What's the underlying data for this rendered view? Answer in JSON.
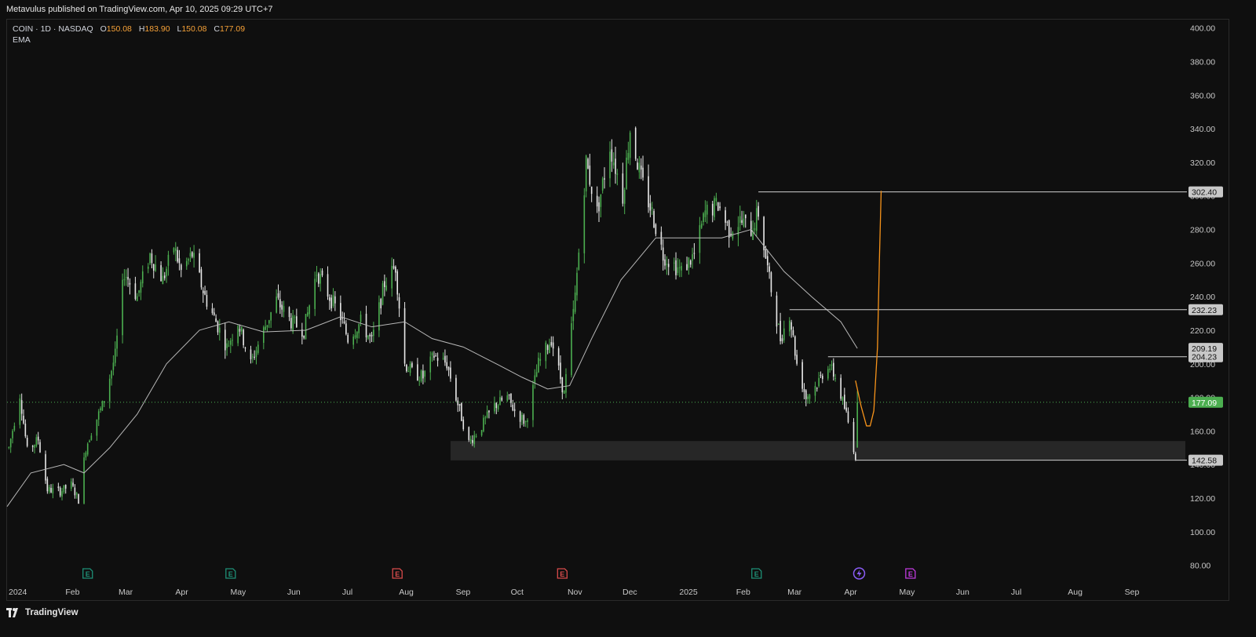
{
  "header": {
    "publisher": "Metavulus published on TradingView.com, Apr 10, 2025 09:29 UTC+7"
  },
  "legend": {
    "symbol": "COIN · 1D · NASDAQ",
    "o_label": "O",
    "o_value": "150.08",
    "h_label": "H",
    "h_value": "183.90",
    "l_label": "L",
    "l_value": "150.08",
    "c_label": "C",
    "c_value": "177.09",
    "indicator": "EMA"
  },
  "footer": {
    "brand": "TradingView"
  },
  "colors": {
    "background": "#0f0f0f",
    "up": "#4caf50",
    "down": "#e8e8e8",
    "ema": "#b8b8b8",
    "projection": "#f7931a",
    "level_line": "#d0d0d0",
    "price_badge": "#4caf50",
    "zone": "#2a2a2a",
    "earnings_teal": "#1e8f76",
    "earnings_red": "#d84b4b",
    "earnings_magenta": "#c03adf",
    "dividend_purple": "#8a5cf6"
  },
  "chart_data": {
    "type": "candlestick",
    "symbol": "COIN",
    "interval": "1D",
    "exchange": "NASDAQ",
    "ylim": [
      70,
      405
    ],
    "y_ticks": [
      80,
      100,
      120,
      140,
      160,
      180,
      200,
      220,
      240,
      260,
      280,
      300,
      320,
      340,
      360,
      380,
      400
    ],
    "y_tick_labels": [
      "80.00",
      "100.00",
      "120.00",
      "140.00",
      "160.00",
      "180.00",
      "200.00",
      "220.00",
      "240.00",
      "260.00",
      "280.00",
      "300.00",
      "320.00",
      "340.00",
      "360.00",
      "380.00",
      "400.00"
    ],
    "x_range": [
      "2024-01-01",
      "2025-10-05"
    ],
    "x_ticks": [
      {
        "date": "2024-01-01",
        "label": "2024"
      },
      {
        "date": "2024-02-01",
        "label": "Feb"
      },
      {
        "date": "2024-03-01",
        "label": "Mar"
      },
      {
        "date": "2024-04-01",
        "label": "Apr"
      },
      {
        "date": "2024-05-01",
        "label": "May"
      },
      {
        "date": "2024-06-01",
        "label": "Jun"
      },
      {
        "date": "2024-07-01",
        "label": "Jul"
      },
      {
        "date": "2024-08-01",
        "label": "Aug"
      },
      {
        "date": "2024-09-01",
        "label": "Sep"
      },
      {
        "date": "2024-10-01",
        "label": "Oct"
      },
      {
        "date": "2024-11-01",
        "label": "Nov"
      },
      {
        "date": "2024-12-01",
        "label": "Dec"
      },
      {
        "date": "2025-01-01",
        "label": "2025"
      },
      {
        "date": "2025-02-01",
        "label": "Feb"
      },
      {
        "date": "2025-03-01",
        "label": "Mar"
      },
      {
        "date": "2025-04-01",
        "label": "Apr"
      },
      {
        "date": "2025-05-01",
        "label": "May"
      },
      {
        "date": "2025-06-01",
        "label": "Jun"
      },
      {
        "date": "2025-07-01",
        "label": "Jul"
      },
      {
        "date": "2025-08-01",
        "label": "Aug"
      },
      {
        "date": "2025-09-01",
        "label": "Sep"
      }
    ],
    "price_path": [
      [
        "2024-01-02",
        150
      ],
      [
        "2024-01-08",
        182
      ],
      [
        "2024-01-12",
        148
      ],
      [
        "2024-01-18",
        155
      ],
      [
        "2024-01-23",
        125
      ],
      [
        "2024-01-30",
        124
      ],
      [
        "2024-02-05",
        128
      ],
      [
        "2024-02-09",
        119
      ],
      [
        "2024-02-13",
        150
      ],
      [
        "2024-02-16",
        160
      ],
      [
        "2024-02-22",
        175
      ],
      [
        "2024-02-29",
        205
      ],
      [
        "2024-03-05",
        255
      ],
      [
        "2024-03-12",
        240
      ],
      [
        "2024-03-19",
        265
      ],
      [
        "2024-03-26",
        250
      ],
      [
        "2024-04-01",
        270
      ],
      [
        "2024-04-05",
        255
      ],
      [
        "2024-04-11",
        265
      ],
      [
        "2024-04-18",
        240
      ],
      [
        "2024-04-24",
        225
      ],
      [
        "2024-04-30",
        210
      ],
      [
        "2024-05-06",
        225
      ],
      [
        "2024-05-13",
        200
      ],
      [
        "2024-05-20",
        220
      ],
      [
        "2024-05-27",
        238
      ],
      [
        "2024-06-04",
        225
      ],
      [
        "2024-06-11",
        220
      ],
      [
        "2024-06-18",
        255
      ],
      [
        "2024-06-25",
        240
      ],
      [
        "2024-07-01",
        228
      ],
      [
        "2024-07-05",
        215
      ],
      [
        "2024-07-12",
        225
      ],
      [
        "2024-07-18",
        213
      ],
      [
        "2024-07-25",
        248
      ],
      [
        "2024-07-31",
        258
      ],
      [
        "2024-08-05",
        200
      ],
      [
        "2024-08-09",
        195
      ],
      [
        "2024-08-15",
        192
      ],
      [
        "2024-08-21",
        205
      ],
      [
        "2024-08-28",
        200
      ],
      [
        "2024-09-04",
        172
      ],
      [
        "2024-09-09",
        153
      ],
      [
        "2024-09-16",
        163
      ],
      [
        "2024-09-23",
        175
      ],
      [
        "2024-09-30",
        180
      ],
      [
        "2024-10-04",
        172
      ],
      [
        "2024-10-10",
        165
      ],
      [
        "2024-10-17",
        200
      ],
      [
        "2024-10-24",
        215
      ],
      [
        "2024-10-31",
        182
      ],
      [
        "2024-11-06",
        240
      ],
      [
        "2024-11-12",
        320
      ],
      [
        "2024-11-18",
        290
      ],
      [
        "2024-11-25",
        330
      ],
      [
        "2024-12-02",
        300
      ],
      [
        "2024-12-06",
        340
      ],
      [
        "2024-12-12",
        310
      ],
      [
        "2024-12-18",
        290
      ],
      [
        "2024-12-24",
        265
      ],
      [
        "2025-01-03",
        255
      ],
      [
        "2025-01-10",
        265
      ],
      [
        "2025-01-16",
        290
      ],
      [
        "2025-01-23",
        295
      ],
      [
        "2025-01-29",
        280
      ],
      [
        "2025-02-04",
        285
      ],
      [
        "2025-02-10",
        280
      ],
      [
        "2025-02-14",
        290
      ],
      [
        "2025-02-20",
        250
      ],
      [
        "2025-02-26",
        215
      ],
      [
        "2025-03-03",
        230
      ],
      [
        "2025-03-07",
        200
      ],
      [
        "2025-03-12",
        180
      ],
      [
        "2025-03-18",
        188
      ],
      [
        "2025-03-24",
        200
      ],
      [
        "2025-03-28",
        192
      ],
      [
        "2025-04-03",
        170
      ],
      [
        "2025-04-08",
        145
      ],
      [
        "2025-04-09",
        177
      ]
    ],
    "last_candle": {
      "date": "2025-04-09",
      "open": 150.08,
      "high": 183.9,
      "low": 150.08,
      "close": 177.09
    },
    "ema_path": [
      [
        "2024-01-01",
        115
      ],
      [
        "2024-01-14",
        135
      ],
      [
        "2024-02-01",
        140
      ],
      [
        "2024-02-12",
        135
      ],
      [
        "2024-02-26",
        150
      ],
      [
        "2024-03-12",
        170
      ],
      [
        "2024-03-28",
        200
      ],
      [
        "2024-04-15",
        220
      ],
      [
        "2024-05-01",
        225
      ],
      [
        "2024-05-20",
        219
      ],
      [
        "2024-06-12",
        220
      ],
      [
        "2024-07-01",
        228
      ],
      [
        "2024-07-18",
        222
      ],
      [
        "2024-08-05",
        225
      ],
      [
        "2024-08-20",
        215
      ],
      [
        "2024-09-06",
        210
      ],
      [
        "2024-09-24",
        200
      ],
      [
        "2024-10-08",
        192
      ],
      [
        "2024-10-22",
        185
      ],
      [
        "2024-11-03",
        187
      ],
      [
        "2024-11-15",
        215
      ],
      [
        "2024-12-01",
        250
      ],
      [
        "2024-12-20",
        275
      ],
      [
        "2025-01-08",
        275
      ],
      [
        "2025-01-25",
        275
      ],
      [
        "2025-02-10",
        280
      ],
      [
        "2025-02-28",
        255
      ],
      [
        "2025-03-15",
        240
      ],
      [
        "2025-03-31",
        225
      ],
      [
        "2025-04-09",
        209.19
      ]
    ],
    "projection_path": [
      [
        "2025-04-08",
        190
      ],
      [
        "2025-04-11",
        175
      ],
      [
        "2025-04-14",
        163
      ],
      [
        "2025-04-16",
        163
      ],
      [
        "2025-04-18",
        172
      ],
      [
        "2025-04-20",
        210
      ],
      [
        "2025-04-21",
        260
      ],
      [
        "2025-04-22",
        303
      ]
    ],
    "levels": [
      {
        "value": 302.4,
        "label": "302.40",
        "from": "2025-02-14"
      },
      {
        "value": 232.23,
        "label": "232.23",
        "from": "2025-03-03"
      },
      {
        "value": 204.23,
        "label": "204.23",
        "from": "2025-03-24"
      },
      {
        "value": 142.58,
        "label": "142.58",
        "from": "2025-04-08"
      }
    ],
    "ema_badge": {
      "value": 209.19,
      "label": "209.19"
    },
    "last_price": {
      "value": 177.09,
      "label": "177.09"
    },
    "support_zone": {
      "from": "2024-08-30",
      "to": "2025-10-05",
      "low": 142.5,
      "high": 154
    },
    "events": [
      {
        "date": "2024-02-14",
        "type": "earnings",
        "color": "teal",
        "label": "E"
      },
      {
        "date": "2024-05-02",
        "type": "earnings",
        "color": "teal",
        "label": "E"
      },
      {
        "date": "2024-08-01",
        "type": "earnings",
        "color": "red",
        "label": "E"
      },
      {
        "date": "2024-10-30",
        "type": "earnings",
        "color": "red",
        "label": "E"
      },
      {
        "date": "2025-02-13",
        "type": "earnings",
        "color": "teal",
        "label": "E"
      },
      {
        "date": "2025-04-10",
        "type": "split",
        "color": "purple",
        "label": ""
      },
      {
        "date": "2025-05-08",
        "type": "earnings",
        "color": "magenta",
        "label": "E"
      }
    ]
  }
}
